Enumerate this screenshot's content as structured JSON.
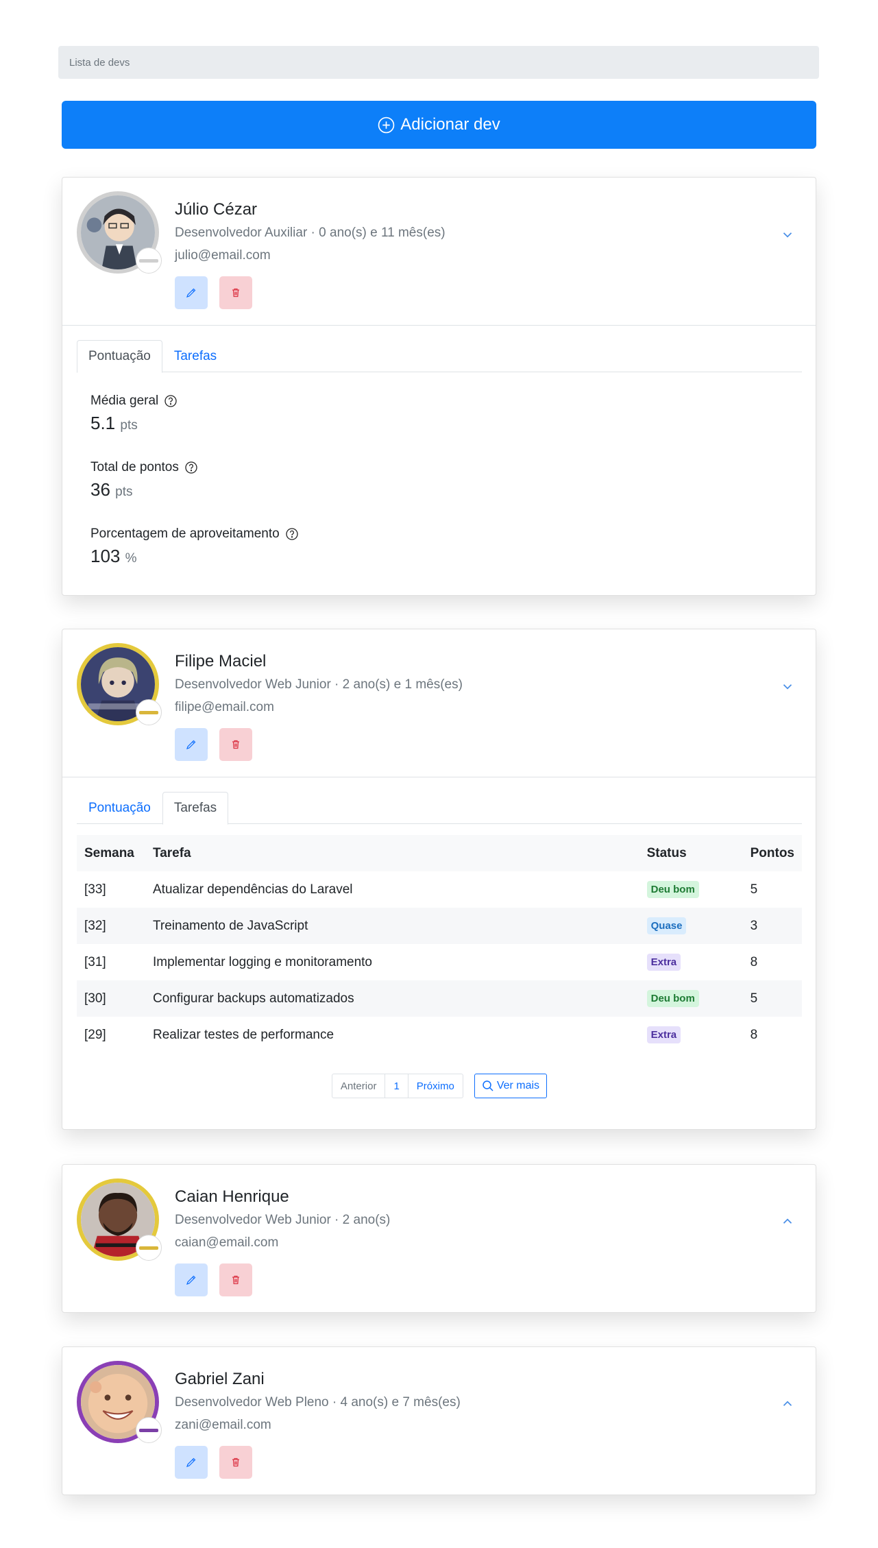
{
  "breadcrumb": {
    "label": "Lista de devs"
  },
  "add_button": {
    "label": "Adicionar dev"
  },
  "tab_labels": {
    "score": "Pontuação",
    "tasks": "Tarefas"
  },
  "score_labels": {
    "average": "Média geral",
    "total": "Total de pontos",
    "percentage": "Porcentagem de aproveitamento",
    "pts_unit": "pts",
    "pct_unit": "%"
  },
  "task_table_headers": {
    "week": "Semana",
    "task": "Tarefa",
    "status": "Status",
    "points": "Pontos"
  },
  "pagination": {
    "prev": "Anterior",
    "page": "1",
    "next": "Próximo",
    "more": "Ver mais"
  },
  "devs": [
    {
      "name": "Júlio Cézar",
      "role": "Desenvolvedor Auxiliar · 0 ano(s) e 11 mês(es)",
      "email": "julio@email.com",
      "rank_color": "#cfcfcf",
      "expanded_tab": "Pontuação",
      "score": {
        "average": "5.1",
        "total": "36",
        "percentage": "103"
      }
    },
    {
      "name": "Filipe Maciel",
      "role": "Desenvolvedor Web Junior · 2 ano(s) e 1 mês(es)",
      "email": "filipe@email.com",
      "rank_color": "#d9b63a",
      "expanded_tab": "Tarefas",
      "tasks": [
        {
          "week": "[33]",
          "task": "Atualizar dependências do Laravel",
          "status": "Deu bom",
          "points": "5"
        },
        {
          "week": "[32]",
          "task": "Treinamento de JavaScript",
          "status": "Quase",
          "points": "3"
        },
        {
          "week": "[31]",
          "task": "Implementar logging e monitoramento",
          "status": "Extra",
          "points": "8"
        },
        {
          "week": "[30]",
          "task": "Configurar backups automatizados",
          "status": "Deu bom",
          "points": "5"
        },
        {
          "week": "[29]",
          "task": "Realizar testes de performance",
          "status": "Extra",
          "points": "8"
        }
      ]
    },
    {
      "name": "Caian Henrique",
      "role": "Desenvolvedor Web Junior · 2 ano(s)",
      "email": "caian@email.com",
      "rank_color": "#d9b63a"
    },
    {
      "name": "Gabriel Zani",
      "role": "Desenvolvedor Web Pleno · 4 ano(s) e 7 mês(es)",
      "email": "zani@email.com",
      "rank_color": "#7b3fa6"
    }
  ],
  "colors": {
    "primary": "#0d7ff9",
    "gold": "#e4c93c",
    "purple": "#8a3fb5"
  }
}
